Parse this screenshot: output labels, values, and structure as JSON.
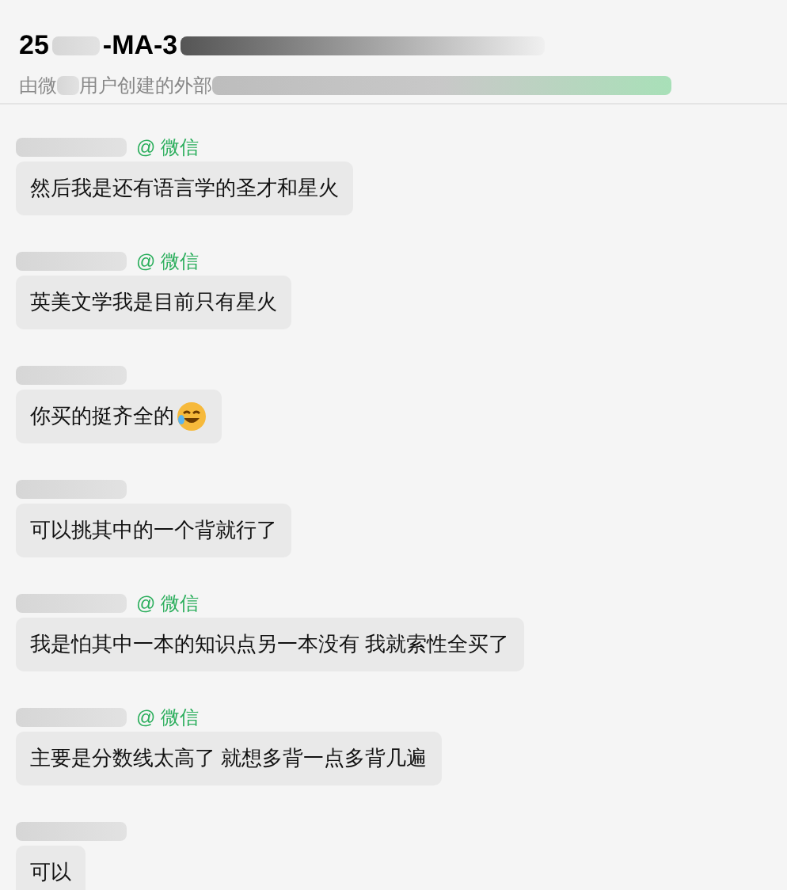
{
  "header": {
    "title_start": "25",
    "title_end": "-MA-3",
    "subtitle_start": "由微",
    "subtitle_end": "用户创建的外部"
  },
  "messages": [
    {
      "sender_tag": "@ 微信",
      "text": "然后我是还有语言学的圣才和星火",
      "has_emoji": false
    },
    {
      "sender_tag": "@ 微信",
      "text": "英美文学我是目前只有星火",
      "has_emoji": false
    },
    {
      "text": "你买的挺齐全的",
      "has_emoji": true
    },
    {
      "text": "可以挑其中的一个背就行了",
      "has_emoji": false
    },
    {
      "sender_tag": "@ 微信",
      "text": "我是怕其中一本的知识点另一本没有 我就索性全买了",
      "has_emoji": false
    },
    {
      "sender_tag": "@ 微信",
      "text": "主要是分数线太高了 就想多背一点多背几遍",
      "has_emoji": false
    },
    {
      "text": "可以",
      "has_emoji": false
    }
  ]
}
